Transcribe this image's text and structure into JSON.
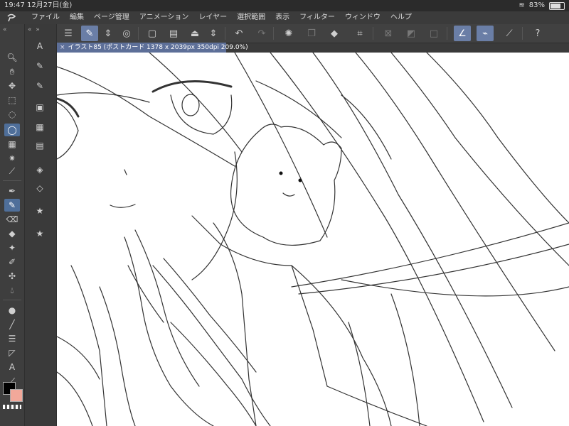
{
  "status": {
    "time": "19:47",
    "date": "12月27日(金)",
    "battery": "83%"
  },
  "menu": [
    "ファイル",
    "編集",
    "ページ管理",
    "アニメーション",
    "レイヤー",
    "選択範囲",
    "表示",
    "フィルター",
    "ウィンドウ",
    "ヘルプ"
  ],
  "document": {
    "tab_title": "イラスト85 (ポストカード 1378 x 2039px 350dpi 209.0%)"
  },
  "colors": {
    "foreground": "#000000",
    "background": "#f2a89a",
    "accent": "#6a7ea6"
  },
  "tools": [
    "zoom-icon",
    "hand-icon",
    "move-icon",
    "transform-icon",
    "lasso-icon",
    "selection-icon",
    "magic-wand-icon",
    "eyedropper-icon",
    "pen-icon",
    "pencil-icon",
    "eraser-icon",
    "fill-icon",
    "sparkle-icon",
    "brush-icon",
    "gradient-icon",
    "blend-icon",
    "shape-icon",
    "line-icon",
    "ruler-icon",
    "text-icon",
    "balloon-icon"
  ],
  "subtools": [
    "subtool-1",
    "subtool-2",
    "subtool-3",
    "subtool-4",
    "subtool-5",
    "subtool-6",
    "subtool-7",
    "subtool-8",
    "subtool-9",
    "subtool-10"
  ]
}
